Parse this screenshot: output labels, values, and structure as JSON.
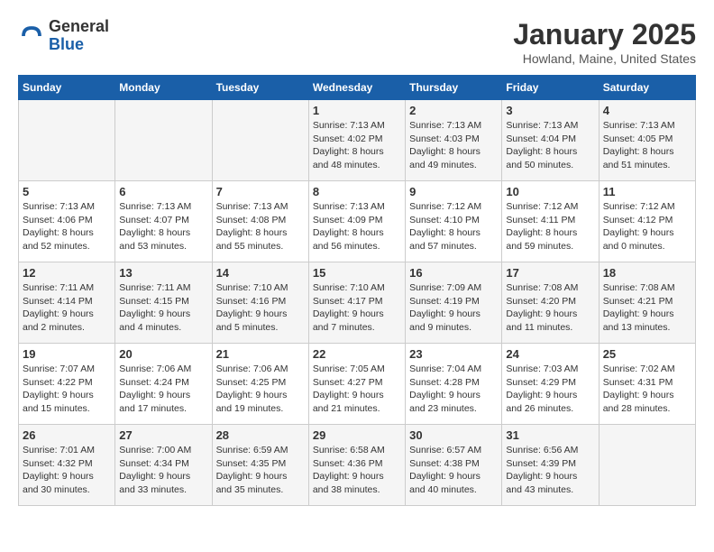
{
  "header": {
    "logo_general": "General",
    "logo_blue": "Blue",
    "month": "January 2025",
    "location": "Howland, Maine, United States"
  },
  "days_of_week": [
    "Sunday",
    "Monday",
    "Tuesday",
    "Wednesday",
    "Thursday",
    "Friday",
    "Saturday"
  ],
  "weeks": [
    [
      {
        "day": "",
        "info": ""
      },
      {
        "day": "",
        "info": ""
      },
      {
        "day": "",
        "info": ""
      },
      {
        "day": "1",
        "info": "Sunrise: 7:13 AM\nSunset: 4:02 PM\nDaylight: 8 hours and 48 minutes."
      },
      {
        "day": "2",
        "info": "Sunrise: 7:13 AM\nSunset: 4:03 PM\nDaylight: 8 hours and 49 minutes."
      },
      {
        "day": "3",
        "info": "Sunrise: 7:13 AM\nSunset: 4:04 PM\nDaylight: 8 hours and 50 minutes."
      },
      {
        "day": "4",
        "info": "Sunrise: 7:13 AM\nSunset: 4:05 PM\nDaylight: 8 hours and 51 minutes."
      }
    ],
    [
      {
        "day": "5",
        "info": "Sunrise: 7:13 AM\nSunset: 4:06 PM\nDaylight: 8 hours and 52 minutes."
      },
      {
        "day": "6",
        "info": "Sunrise: 7:13 AM\nSunset: 4:07 PM\nDaylight: 8 hours and 53 minutes."
      },
      {
        "day": "7",
        "info": "Sunrise: 7:13 AM\nSunset: 4:08 PM\nDaylight: 8 hours and 55 minutes."
      },
      {
        "day": "8",
        "info": "Sunrise: 7:13 AM\nSunset: 4:09 PM\nDaylight: 8 hours and 56 minutes."
      },
      {
        "day": "9",
        "info": "Sunrise: 7:12 AM\nSunset: 4:10 PM\nDaylight: 8 hours and 57 minutes."
      },
      {
        "day": "10",
        "info": "Sunrise: 7:12 AM\nSunset: 4:11 PM\nDaylight: 8 hours and 59 minutes."
      },
      {
        "day": "11",
        "info": "Sunrise: 7:12 AM\nSunset: 4:12 PM\nDaylight: 9 hours and 0 minutes."
      }
    ],
    [
      {
        "day": "12",
        "info": "Sunrise: 7:11 AM\nSunset: 4:14 PM\nDaylight: 9 hours and 2 minutes."
      },
      {
        "day": "13",
        "info": "Sunrise: 7:11 AM\nSunset: 4:15 PM\nDaylight: 9 hours and 4 minutes."
      },
      {
        "day": "14",
        "info": "Sunrise: 7:10 AM\nSunset: 4:16 PM\nDaylight: 9 hours and 5 minutes."
      },
      {
        "day": "15",
        "info": "Sunrise: 7:10 AM\nSunset: 4:17 PM\nDaylight: 9 hours and 7 minutes."
      },
      {
        "day": "16",
        "info": "Sunrise: 7:09 AM\nSunset: 4:19 PM\nDaylight: 9 hours and 9 minutes."
      },
      {
        "day": "17",
        "info": "Sunrise: 7:08 AM\nSunset: 4:20 PM\nDaylight: 9 hours and 11 minutes."
      },
      {
        "day": "18",
        "info": "Sunrise: 7:08 AM\nSunset: 4:21 PM\nDaylight: 9 hours and 13 minutes."
      }
    ],
    [
      {
        "day": "19",
        "info": "Sunrise: 7:07 AM\nSunset: 4:22 PM\nDaylight: 9 hours and 15 minutes."
      },
      {
        "day": "20",
        "info": "Sunrise: 7:06 AM\nSunset: 4:24 PM\nDaylight: 9 hours and 17 minutes."
      },
      {
        "day": "21",
        "info": "Sunrise: 7:06 AM\nSunset: 4:25 PM\nDaylight: 9 hours and 19 minutes."
      },
      {
        "day": "22",
        "info": "Sunrise: 7:05 AM\nSunset: 4:27 PM\nDaylight: 9 hours and 21 minutes."
      },
      {
        "day": "23",
        "info": "Sunrise: 7:04 AM\nSunset: 4:28 PM\nDaylight: 9 hours and 23 minutes."
      },
      {
        "day": "24",
        "info": "Sunrise: 7:03 AM\nSunset: 4:29 PM\nDaylight: 9 hours and 26 minutes."
      },
      {
        "day": "25",
        "info": "Sunrise: 7:02 AM\nSunset: 4:31 PM\nDaylight: 9 hours and 28 minutes."
      }
    ],
    [
      {
        "day": "26",
        "info": "Sunrise: 7:01 AM\nSunset: 4:32 PM\nDaylight: 9 hours and 30 minutes."
      },
      {
        "day": "27",
        "info": "Sunrise: 7:00 AM\nSunset: 4:34 PM\nDaylight: 9 hours and 33 minutes."
      },
      {
        "day": "28",
        "info": "Sunrise: 6:59 AM\nSunset: 4:35 PM\nDaylight: 9 hours and 35 minutes."
      },
      {
        "day": "29",
        "info": "Sunrise: 6:58 AM\nSunset: 4:36 PM\nDaylight: 9 hours and 38 minutes."
      },
      {
        "day": "30",
        "info": "Sunrise: 6:57 AM\nSunset: 4:38 PM\nDaylight: 9 hours and 40 minutes."
      },
      {
        "day": "31",
        "info": "Sunrise: 6:56 AM\nSunset: 4:39 PM\nDaylight: 9 hours and 43 minutes."
      },
      {
        "day": "",
        "info": ""
      }
    ]
  ]
}
